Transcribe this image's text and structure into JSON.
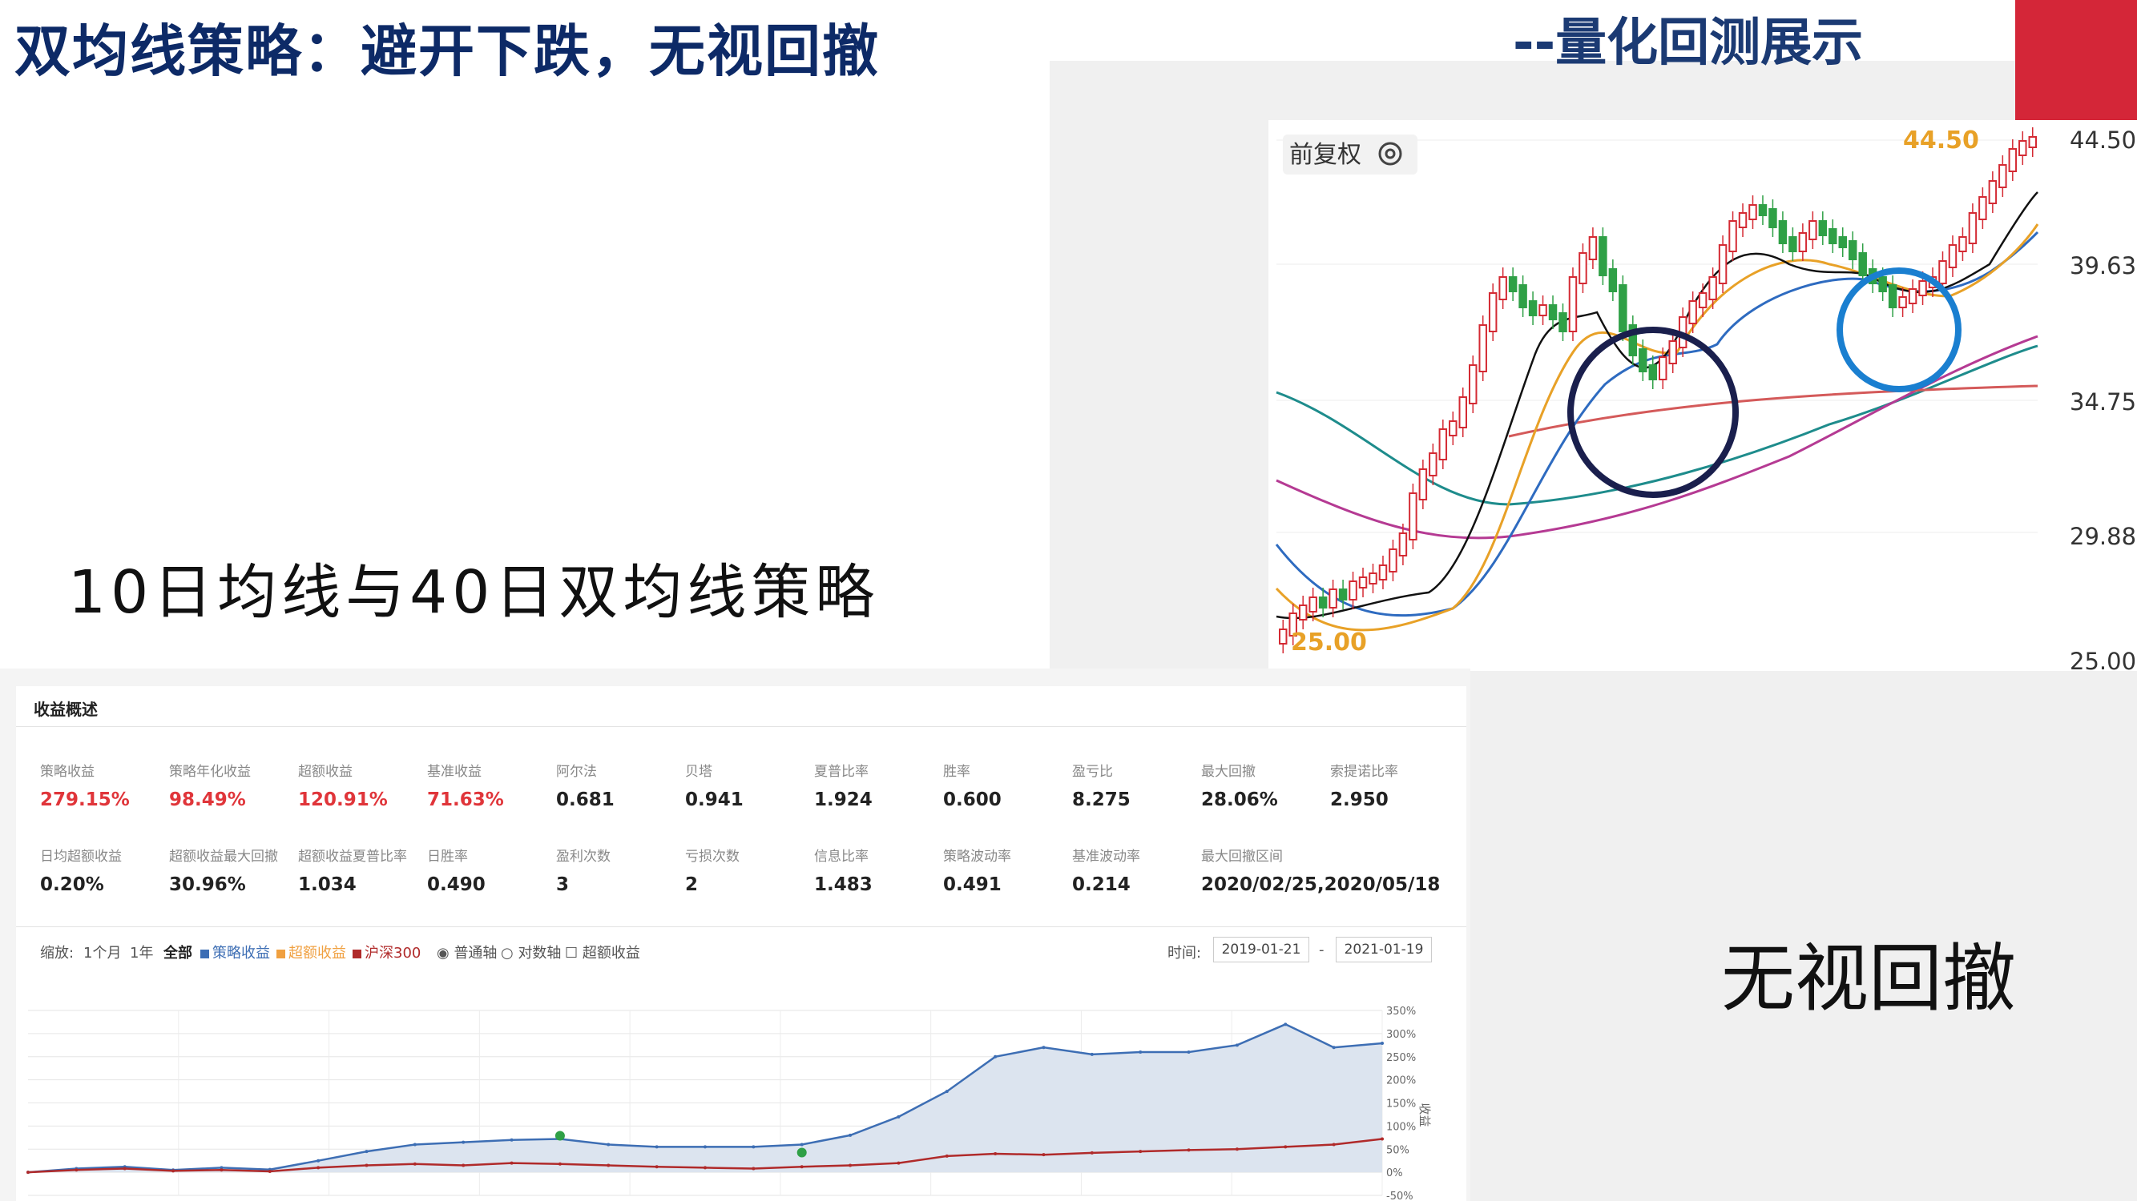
{
  "slide": {
    "title": "双均线策略：避开下跌，无视回撤",
    "subtitle": "--量化回测展示",
    "strategy_label": "10日均线与40日双均线策略",
    "ignore_drawdown_label": "无视回撤",
    "accent_color": "#d42638",
    "title_color": "#0d2a67"
  },
  "kline_chart": {
    "adjust_label": "前复权",
    "adjust_icon": "gear-icon",
    "high_label": "44.50",
    "low_label": "25.00",
    "price_ticks": [
      "44.50",
      "39.63",
      "34.75",
      "29.88",
      "25.00"
    ],
    "price_range": [
      25.0,
      44.5
    ],
    "circle_colors": [
      "#1a1f4d",
      "#1a7fd0"
    ],
    "up_color": "#d42a33",
    "down_color": "#2fa046"
  },
  "summary": {
    "header": "收益概述",
    "metrics_row1": [
      {
        "label": "策略收益",
        "value": "279.15%",
        "highlight": true
      },
      {
        "label": "策略年化收益",
        "value": "98.49%",
        "highlight": true
      },
      {
        "label": "超额收益",
        "value": "120.91%",
        "highlight": true
      },
      {
        "label": "基准收益",
        "value": "71.63%",
        "highlight": true
      },
      {
        "label": "阿尔法",
        "value": "0.681",
        "highlight": false
      },
      {
        "label": "贝塔",
        "value": "0.941",
        "highlight": false
      },
      {
        "label": "夏普比率",
        "value": "1.924",
        "highlight": false
      },
      {
        "label": "胜率",
        "value": "0.600",
        "highlight": false
      },
      {
        "label": "盈亏比",
        "value": "8.275",
        "highlight": false
      },
      {
        "label": "最大回撤",
        "value": "28.06%",
        "highlight": false
      },
      {
        "label": "索提诺比率",
        "value": "2.950",
        "highlight": false
      }
    ],
    "metrics_row2": [
      {
        "label": "日均超额收益",
        "value": "0.20%"
      },
      {
        "label": "超额收益最大回撤",
        "value": "30.96%"
      },
      {
        "label": "超额收益夏普比率",
        "value": "1.034"
      },
      {
        "label": "日胜率",
        "value": "0.490"
      },
      {
        "label": "盈利次数",
        "value": "3"
      },
      {
        "label": "亏损次数",
        "value": "2"
      },
      {
        "label": "信息比率",
        "value": "1.483"
      },
      {
        "label": "策略波动率",
        "value": "0.491"
      },
      {
        "label": "基准波动率",
        "value": "0.214"
      },
      {
        "label": "最大回撤区间",
        "value": "2020/02/25,2020/05/18"
      }
    ],
    "controls": {
      "zoom_label": "缩放:",
      "range_buttons": [
        "1个月",
        "1年",
        "全部"
      ],
      "legend": [
        {
          "label": "策略收益",
          "color": "#3d6eb4"
        },
        {
          "label": "超额收益",
          "color": "#f0a040"
        },
        {
          "label": "沪深300",
          "color": "#b02a2a"
        }
      ],
      "axis_options": [
        "普通轴",
        "对数轴"
      ],
      "excess_checkbox": "超额收益",
      "time_label": "时间:",
      "date_from": "2019-01-21",
      "date_to": "2021-01-19",
      "date_sep": "-"
    },
    "return_chart": {
      "y_ticks": [
        "350%",
        "300%",
        "250%",
        "200%",
        "150%",
        "100%",
        "50%",
        "0%",
        "-50%"
      ],
      "y_axis_label": "收益"
    }
  },
  "chart_data": [
    {
      "type": "line",
      "title": "",
      "x_range": [
        "2019-01-21",
        "2021-01-19"
      ],
      "ylabel": "收益",
      "ylim": [
        -50,
        350
      ],
      "series": [
        {
          "name": "策略收益",
          "values": [
            0,
            8,
            12,
            5,
            10,
            6,
            25,
            45,
            60,
            65,
            70,
            72,
            60,
            55,
            55,
            55,
            60,
            80,
            120,
            175,
            250,
            270,
            255,
            260,
            260,
            275,
            320,
            270,
            279
          ]
        },
        {
          "name": "沪深300",
          "values": [
            0,
            5,
            8,
            3,
            5,
            2,
            10,
            15,
            18,
            15,
            20,
            18,
            15,
            12,
            10,
            8,
            12,
            15,
            20,
            35,
            40,
            38,
            42,
            45,
            48,
            50,
            55,
            60,
            72
          ]
        }
      ]
    }
  ]
}
